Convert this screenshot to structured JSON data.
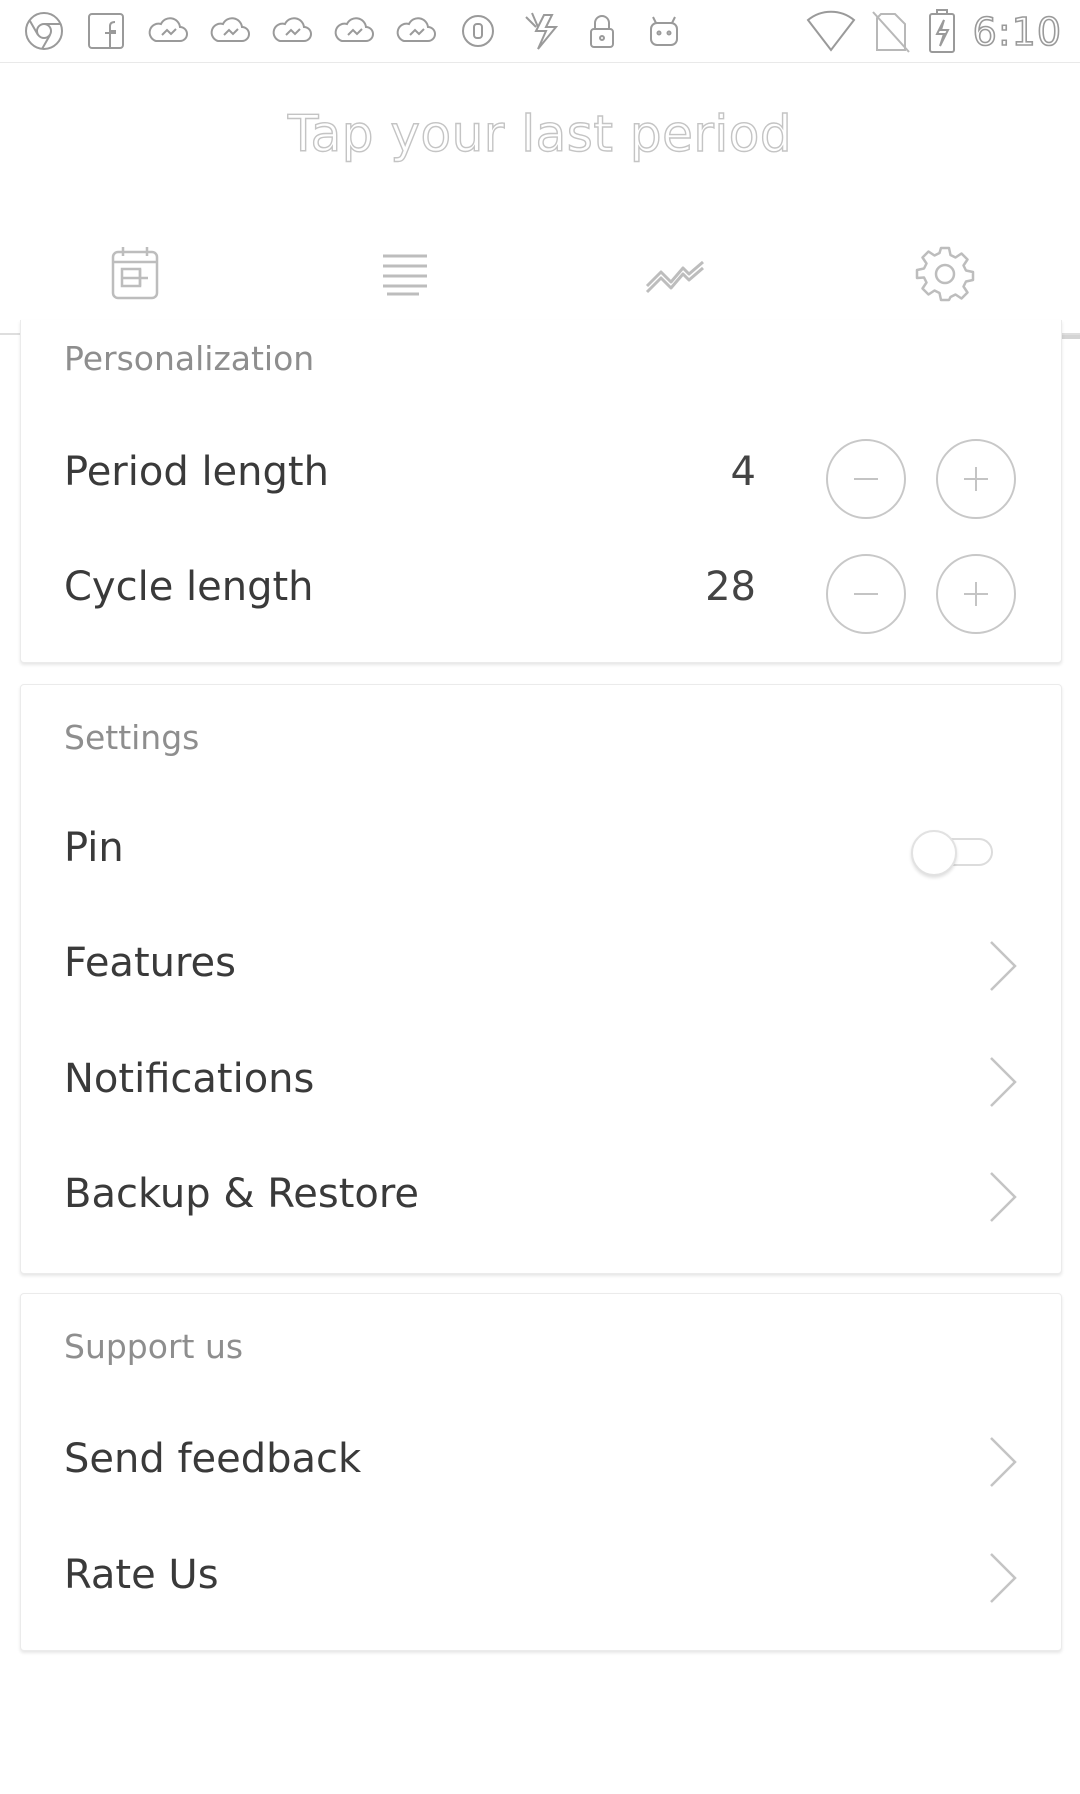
{
  "status_bar": {
    "time": "6:10",
    "left_icons": [
      "chrome-icon",
      "facebook-icon",
      "cloud-sync-icon",
      "cloud-sync-icon",
      "cloud-sync-icon",
      "cloud-sync-icon",
      "cloud-sync-icon",
      "circle-icon",
      "lightning-icon",
      "lock-icon",
      "android-icon"
    ],
    "right_icons": [
      "wifi-icon",
      "no-sim-icon",
      "battery-charging-icon"
    ]
  },
  "header": {
    "title": "Tap your last period"
  },
  "tabs": [
    {
      "icon": "calendar-icon",
      "active": false
    },
    {
      "icon": "list-icon",
      "active": false
    },
    {
      "icon": "chart-line-icon",
      "active": false
    },
    {
      "icon": "gear-icon",
      "active": true
    }
  ],
  "personalization": {
    "title": "Personalization",
    "period_length": {
      "label": "Period length",
      "value": "4"
    },
    "cycle_length": {
      "label": "Cycle length",
      "value": "28"
    }
  },
  "settings": {
    "title": "Settings",
    "pin": {
      "label": "Pin",
      "enabled": false
    },
    "features": {
      "label": "Features"
    },
    "notifications": {
      "label": "Notifications"
    },
    "backup": {
      "label": "Backup & Restore"
    }
  },
  "support": {
    "title": "Support us",
    "feedback": {
      "label": "Send feedback"
    },
    "rate": {
      "label": "Rate Us"
    }
  },
  "colors": {
    "stroke": "#c4c4c4",
    "text": "#3a3a3a",
    "subtle": "#8e8e8e"
  }
}
